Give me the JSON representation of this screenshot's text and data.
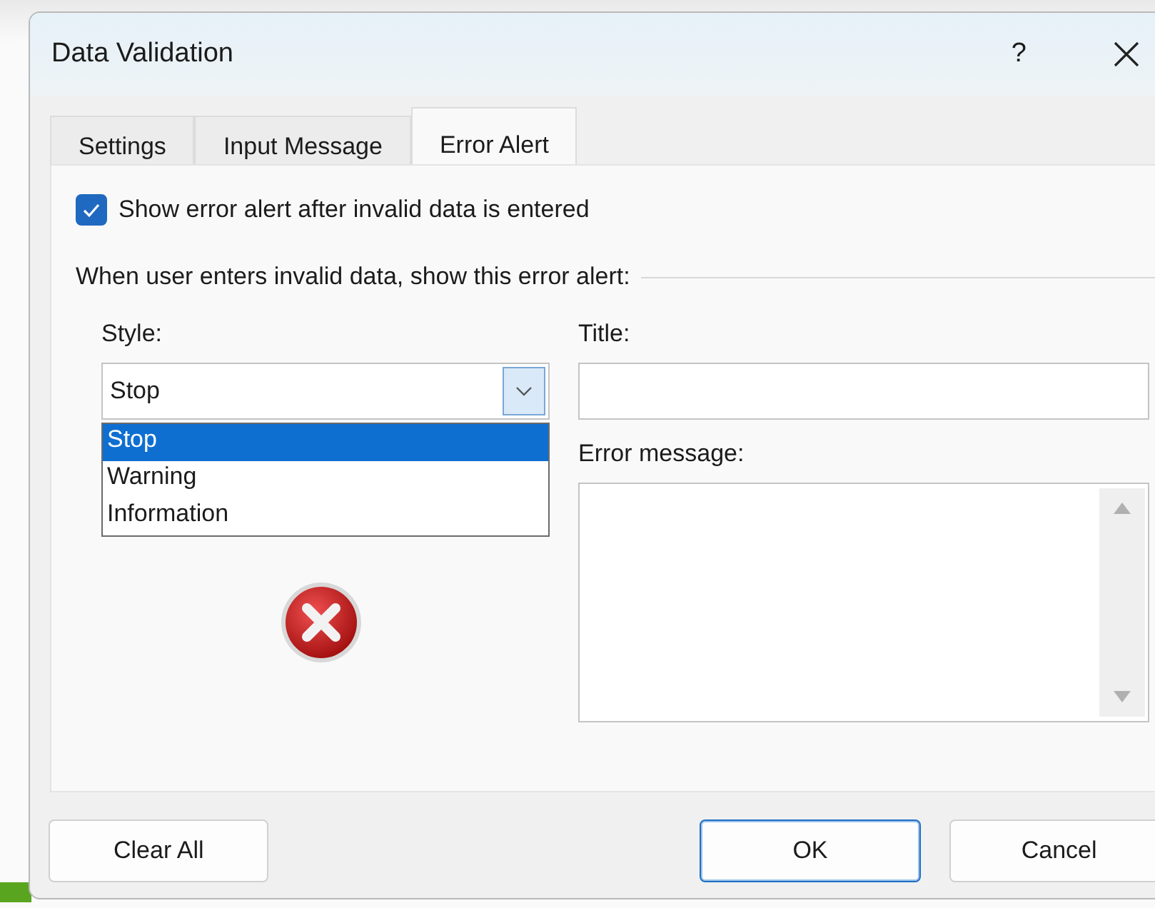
{
  "window": {
    "title": "Data Validation",
    "help": "?"
  },
  "tabs": [
    {
      "label": "Settings",
      "selected": false
    },
    {
      "label": "Input Message",
      "selected": false
    },
    {
      "label": "Error Alert",
      "selected": true
    }
  ],
  "show_alert": {
    "label": "Show error alert after invalid data is entered",
    "checked": true
  },
  "group_label": "When user enters invalid data, show this error alert:",
  "style": {
    "label": "Style:",
    "value": "Stop",
    "expanded": true,
    "options": [
      {
        "label": "Stop",
        "selected": true
      },
      {
        "label": "Warning",
        "selected": false
      },
      {
        "label": "Information",
        "selected": false
      }
    ]
  },
  "title_field": {
    "label": "Title:"
  },
  "error_message": {
    "label": "Error message:"
  },
  "buttons": [
    {
      "label": "Clear All",
      "default": false
    },
    {
      "label": "OK",
      "default": true
    },
    {
      "label": "Cancel",
      "default": false
    }
  ]
}
